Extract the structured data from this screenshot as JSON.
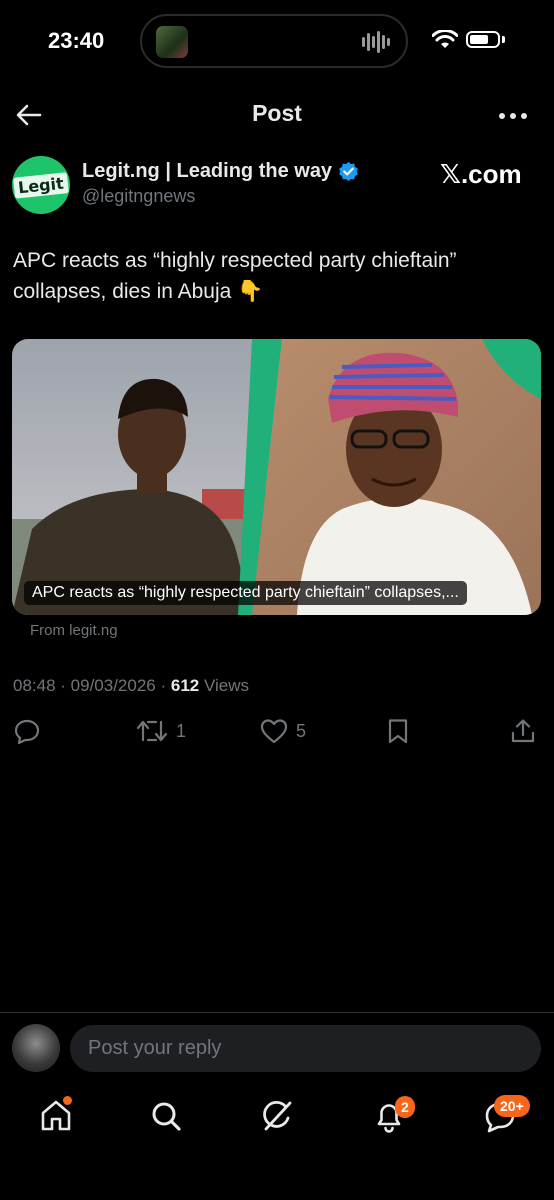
{
  "status": {
    "time": "23:40"
  },
  "nav": {
    "title": "Post"
  },
  "author": {
    "name": "Legit.ng | Leading the way",
    "handle": "@legitngnews",
    "avatar_text": "Legit"
  },
  "brand": "𝕏.com",
  "post": {
    "text": "APC reacts as “highly respected party chieftain” collapses, dies in Abuja 👇",
    "card_caption": "APC reacts as “highly respected party chieftain” collapses,...",
    "card_source": "From legit.ng",
    "time": "08:48",
    "date": "09/03/2026",
    "views": "612",
    "views_label": "Views"
  },
  "actions": {
    "reposts": "1",
    "likes": "5"
  },
  "reply": {
    "placeholder": "Post your reply"
  },
  "tabbar": {
    "notifications_badge": "2",
    "messages_badge": "20+"
  },
  "colors": {
    "accent": "#1d9bf0",
    "badge": "#f8661b",
    "legit_green": "#1ec46a"
  }
}
